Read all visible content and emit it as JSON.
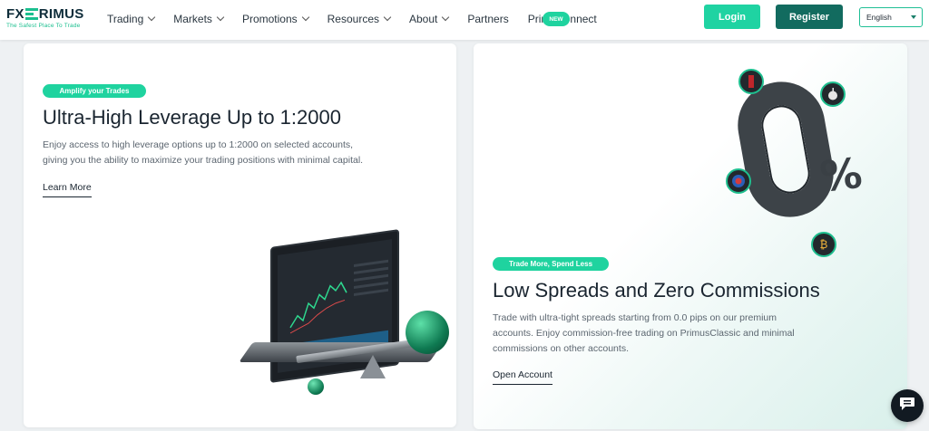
{
  "brand": {
    "name_left": "FX",
    "name_right": "RIMUS",
    "tagline": "The Safest Place To Trade",
    "accent": "#1fd39f",
    "dark_accent": "#126b5f"
  },
  "nav": {
    "items": [
      {
        "label": "Trading",
        "dropdown": true
      },
      {
        "label": "Markets",
        "dropdown": true
      },
      {
        "label": "Promotions",
        "dropdown": true
      },
      {
        "label": "Resources",
        "dropdown": true
      },
      {
        "label": "About",
        "dropdown": true
      },
      {
        "label": "Partners",
        "dropdown": false
      },
      {
        "label": "PrimoConnect",
        "dropdown": false
      }
    ],
    "new_badge": "NEW"
  },
  "header_actions": {
    "login_label": "Login",
    "register_label": "Register",
    "language_selected": "English"
  },
  "cards": {
    "leverage": {
      "pill": "Amplify your Trades",
      "title": "Ultra-High Leverage Up to 1:2000",
      "description_line1": "Enjoy access to high leverage options up to 1:2000 on selected accounts,",
      "description_line2": "giving you the ability to maximize your trading positions with minimal capital.",
      "link": "Learn More"
    },
    "spreads": {
      "pill": "Trade More, Spend Less",
      "title": "Low Spreads and Zero Commissions",
      "description_line1": "Trade with ultra-tight spreads starting from 0.0 pips on our premium",
      "description_line2": "accounts. Enjoy commission-free trading on PrimusClassic and minimal",
      "description_line3": "commissions on other accounts.",
      "link": "Open Account"
    }
  },
  "illustration": {
    "zero_digit": "0",
    "percent_sign": "%"
  },
  "icons": {
    "chat": "chat-bubble-icon",
    "apple": "apple-icon",
    "bitcoin": "bitcoin-icon",
    "flag": "currency-flag-icon",
    "stock": "stock-icon"
  }
}
